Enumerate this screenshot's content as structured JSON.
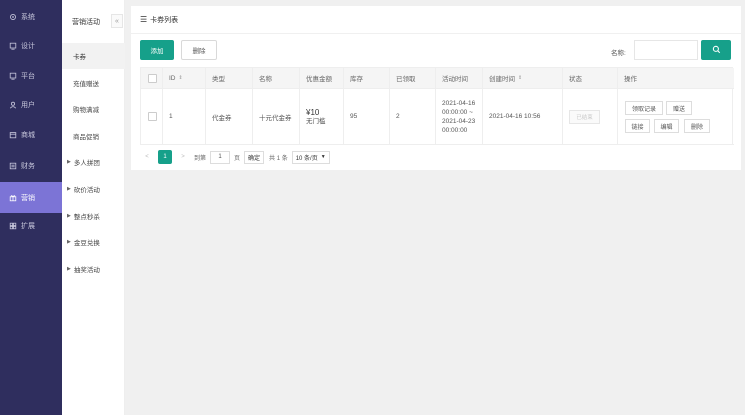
{
  "nav": [
    {
      "label": "系统",
      "icon": "gear-icon"
    },
    {
      "label": "设计",
      "icon": "monitor-icon"
    },
    {
      "label": "平台",
      "icon": "monitor-icon"
    },
    {
      "label": "用户",
      "icon": "user-icon"
    },
    {
      "label": "商城",
      "icon": "shop-icon"
    },
    {
      "label": "财务",
      "icon": "ledger-icon"
    },
    {
      "label": "营销",
      "icon": "gift-icon",
      "active": true
    },
    {
      "label": "扩展",
      "icon": "grid-icon"
    }
  ],
  "sub": {
    "title": "营销活动",
    "collapse": "«",
    "items": [
      {
        "label": "卡券",
        "active": true
      },
      {
        "label": "充值赠送"
      },
      {
        "label": "购物满减"
      },
      {
        "label": "商品促销"
      },
      {
        "label": "多人拼团",
        "group": true
      },
      {
        "label": "砍价活动",
        "group": true
      },
      {
        "label": "整点秒杀",
        "group": true
      },
      {
        "label": "金豆兑换",
        "group": true
      },
      {
        "label": "抽奖活动",
        "group": true
      }
    ]
  },
  "card": {
    "title": "卡券列表",
    "add_label": "添加",
    "delete_label": "删除",
    "search_label": "名称:",
    "search_value": ""
  },
  "table": {
    "headers": [
      "ID",
      "类型",
      "名称",
      "优惠金额",
      "库存",
      "已领取",
      "活动时间",
      "创建时间",
      "状态",
      "操作"
    ],
    "row": {
      "id": "1",
      "type": "代金券",
      "name": "十元代金券",
      "amount": "¥10",
      "amount_note": "无门槛",
      "stock": "95",
      "received": "2",
      "time_start": "2021-04-16",
      "time_start_clock": "00:00:00 ~",
      "time_end": "2021-04-23",
      "time_end_clock": "00:00:00",
      "created": "2021-04-16 10:56",
      "status": "已结束",
      "ops": [
        "领取记录",
        "赠送",
        "链接",
        "编辑",
        "删除"
      ]
    }
  },
  "pager": {
    "prev": "<",
    "current": "1",
    "next": ">",
    "goto_label": "到第",
    "goto_value": "1",
    "page_unit": "页",
    "confirm": "确定",
    "total": "共 1 条",
    "page_size": "10 条/页"
  },
  "colors": {
    "nav_bg": "#2f2e5e",
    "nav_active": "#7c74d6",
    "primary": "#16a08a"
  }
}
